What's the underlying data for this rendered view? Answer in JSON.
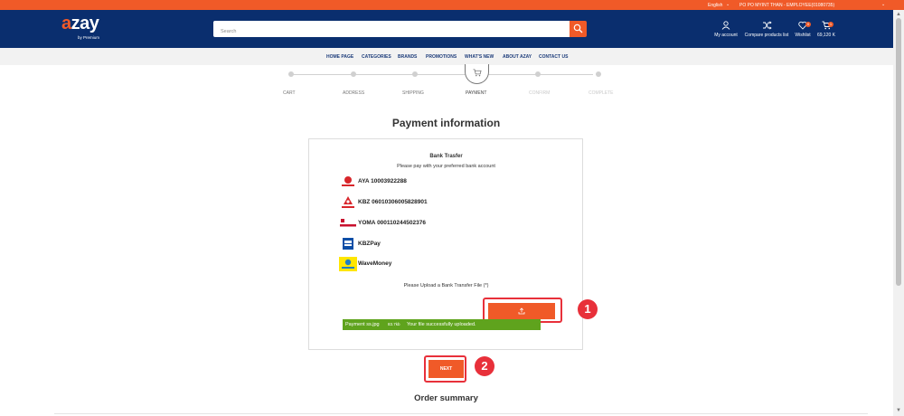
{
  "topbar": {
    "language": "English",
    "user": "PO PO MYINT THAN - EMPLOYEE(01080735)"
  },
  "header": {
    "logo_text": "zay",
    "logo_prefix": "a",
    "logo_sub": "by Premium",
    "search_placeholder": "Search",
    "my_account": "My account",
    "compare": "Compare products list",
    "wishlist": "Wishlist",
    "wishlist_count": "0",
    "cart_total": "69,120 K",
    "cart_count": "1"
  },
  "nav": {
    "items": [
      "HOME PAGE",
      "CATEGORIES",
      "BRANDS",
      "PROMOTIONS",
      "WHAT'S NEW",
      "ABOUT AZAY",
      "CONTACT US"
    ]
  },
  "steps": [
    "CART",
    "ADDRESS",
    "SHIPPING",
    "PAYMENT",
    "CONFIRM",
    "COMPLETE"
  ],
  "current_step": "PAYMENT",
  "payment": {
    "title": "Payment information",
    "method_title": "Bank Trasfer",
    "method_sub": "Please pay with your preferred bank account",
    "banks": [
      {
        "name": "AYA 10003922288",
        "logo": "aya-bank-logo"
      },
      {
        "name": "KBZ 06010306005828901",
        "logo": "kbz-bank-logo"
      },
      {
        "name": "YOMA 000110244502376",
        "logo": "yoma-bank-logo"
      },
      {
        "name": "KBZPay",
        "logo": "kbzpay-logo"
      },
      {
        "name": "WaveMoney",
        "logo": "wavemoney-logo"
      }
    ],
    "upload_label": "Please Upload a Bank Transfer File (*)",
    "uploaded_file": "Payment ss.jpg",
    "uploaded_size": "83.7kb",
    "upload_message": "Your file successfully uploaded.",
    "next_label": "NEXT"
  },
  "annotations": {
    "first": "1",
    "second": "2"
  },
  "order_summary_title": "Order summary",
  "colors": {
    "brand_orange": "#f05a28",
    "header_navy": "#0a2e6e",
    "success_green": "#5fa31d",
    "highlight_red": "#e8303a"
  }
}
